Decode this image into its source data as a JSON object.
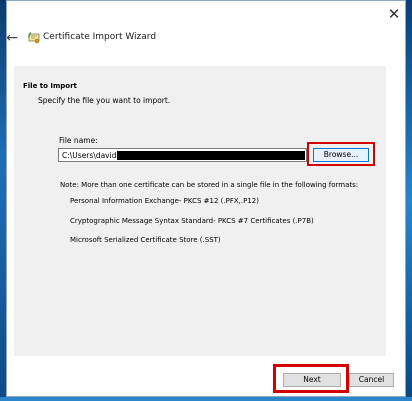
{
  "window": {
    "title": "Certificate Import Wizard",
    "close_glyph": "✕",
    "back_glyph": "←"
  },
  "page": {
    "heading": "File to Import",
    "subheading": "Specify the file you want to import."
  },
  "file": {
    "label": "File name:",
    "value": "C:\\Users\\david",
    "browse_label": "Browse..."
  },
  "note": "Note:  More than one certificate can be stored in a single file in the following formats:",
  "formats": [
    "Personal Information Exchange- PKCS #12 (.PFX,.P12)",
    "Cryptographic Message Syntax Standard- PKCS #7 Certificates (.P7B)",
    "Microsoft Serialized Certificate Store (.SST)"
  ],
  "buttons": {
    "next": "Next",
    "cancel": "Cancel"
  },
  "colors": {
    "highlight": "#d40000",
    "browse_border": "#0078d7"
  },
  "icons": {
    "title": "certificate-icon",
    "back": "back-arrow-icon",
    "close": "close-icon"
  }
}
